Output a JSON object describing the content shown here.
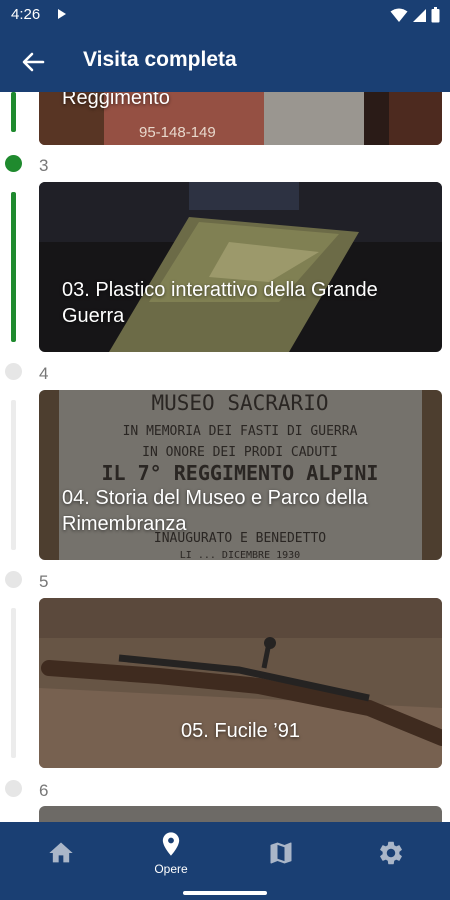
{
  "status_bar": {
    "time": "4:26"
  },
  "app_bar": {
    "title": "Visita completa"
  },
  "timeline": {
    "items": [
      {
        "caption": "Reggimento"
      },
      {
        "number": "3",
        "caption": "03. Plastico interattivo della Grande Guerra"
      },
      {
        "number": "4",
        "caption": "04. Storia del Museo e Parco della Rimembranza"
      },
      {
        "number": "5",
        "caption": "05. Fucile ’91"
      },
      {
        "number": "6"
      }
    ]
  },
  "photo_text": {
    "flag_numbers": "95-148-149",
    "plaque_line1": "MUSEO SACRARIO",
    "plaque_line2": "IN MEMORIA DEI FASTI DI GUERRA",
    "plaque_line3": "IN ONORE DEI PRODI CADUTI",
    "plaque_line4": "IL 7° REGGIMENTO ALPINI",
    "plaque_line5": "INAUGURATO E BENEDETTO",
    "plaque_line6": "LI ... DICEMBRE 1930"
  },
  "bottom_nav": {
    "items": [
      {
        "icon": "home-icon",
        "label": ""
      },
      {
        "icon": "location-pin-icon",
        "label": "Opere"
      },
      {
        "icon": "map-icon",
        "label": ""
      },
      {
        "icon": "gear-icon",
        "label": ""
      }
    ]
  },
  "colors": {
    "primary": "#1a3f73",
    "progress": "#1f8a2e",
    "inactive": "#e6e6e6"
  }
}
